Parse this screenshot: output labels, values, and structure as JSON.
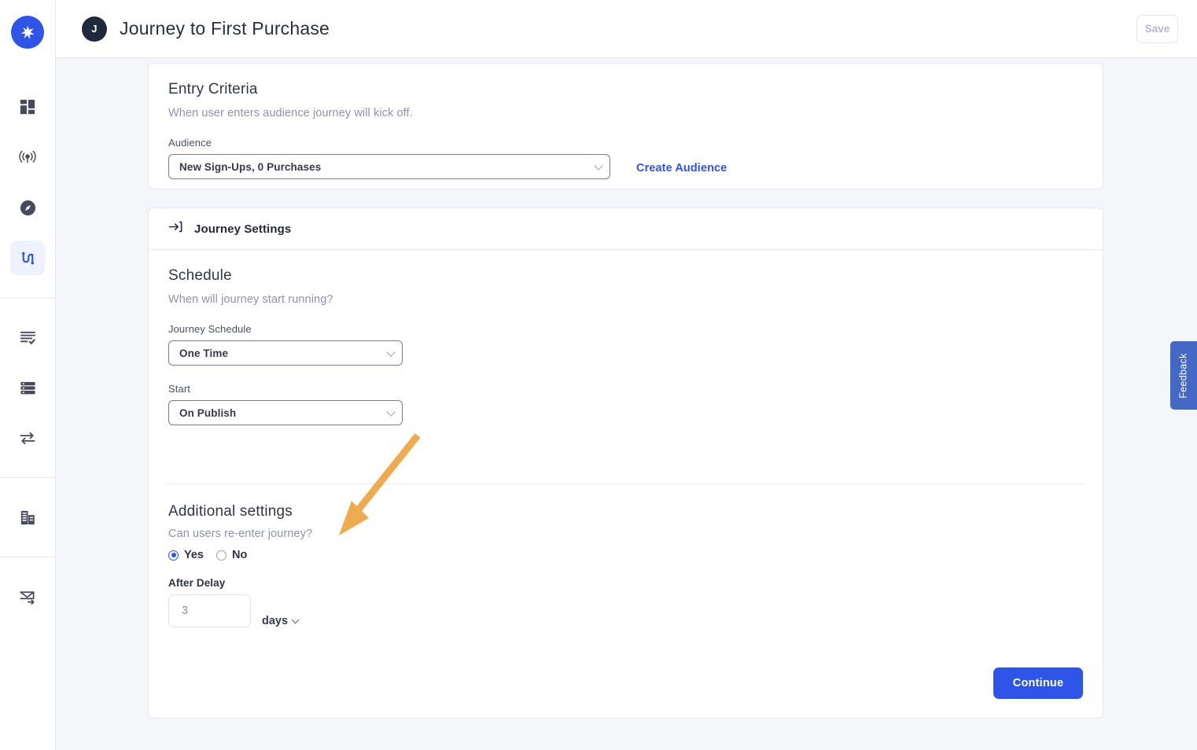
{
  "app": {
    "logo_icon": "spark-star-logo",
    "accent_color": "#2f55e8",
    "page_background": "#f4f6fa",
    "annotation_arrow_color": "#eeab4f"
  },
  "sidebar": {
    "items": [
      {
        "icon": "dashboard-grid-icon",
        "name": "dashboard",
        "active": false
      },
      {
        "icon": "broadcast-signal-icon",
        "name": "campaigns",
        "active": false
      },
      {
        "icon": "compass-icon",
        "name": "explore",
        "active": false
      },
      {
        "icon": "journey-path-icon",
        "name": "journeys",
        "active": true
      },
      {
        "icon": "list-check-icon",
        "name": "tasks",
        "active": false
      },
      {
        "icon": "database-server-icon",
        "name": "data",
        "active": false
      },
      {
        "icon": "transfer-arrows-icon",
        "name": "integrations",
        "active": false
      },
      {
        "icon": "building-icon",
        "name": "company",
        "active": false
      },
      {
        "icon": "envelope-send-icon",
        "name": "messages",
        "active": false
      }
    ]
  },
  "header": {
    "avatar_initial": "J",
    "title": "Journey to First Purchase",
    "save_label": "Save",
    "save_disabled": true
  },
  "entry_criteria": {
    "title": "Entry Criteria",
    "subtitle": "When user enters audience journey will kick off.",
    "audience_label": "Audience",
    "audience_value": "New Sign-Ups, 0 Purchases",
    "audience_options": [
      "New Sign-Ups, 0 Purchases"
    ],
    "create_audience_label": "Create Audience",
    "chevron_icon": "chevron-down-icon"
  },
  "journey_settings": {
    "header_icon": "enter-arrow-icon",
    "header_label": "Journey Settings",
    "schedule": {
      "title": "Schedule",
      "subtitle": "When will journey start running?",
      "journey_schedule_label": "Journey Schedule",
      "journey_schedule_value": "One Time",
      "journey_schedule_options": [
        "One Time"
      ],
      "start_label": "Start",
      "start_value": "On Publish",
      "start_options": [
        "On Publish"
      ]
    },
    "additional": {
      "title": "Additional settings",
      "question": "Can users re-enter journey?",
      "yes_label": "Yes",
      "no_label": "No",
      "selected": "Yes",
      "delay_label": "After Delay",
      "delay_value": "3",
      "delay_unit": "days",
      "delay_unit_options": [
        "days"
      ]
    },
    "continue_label": "Continue"
  },
  "feedback": {
    "label": "Feedback"
  }
}
